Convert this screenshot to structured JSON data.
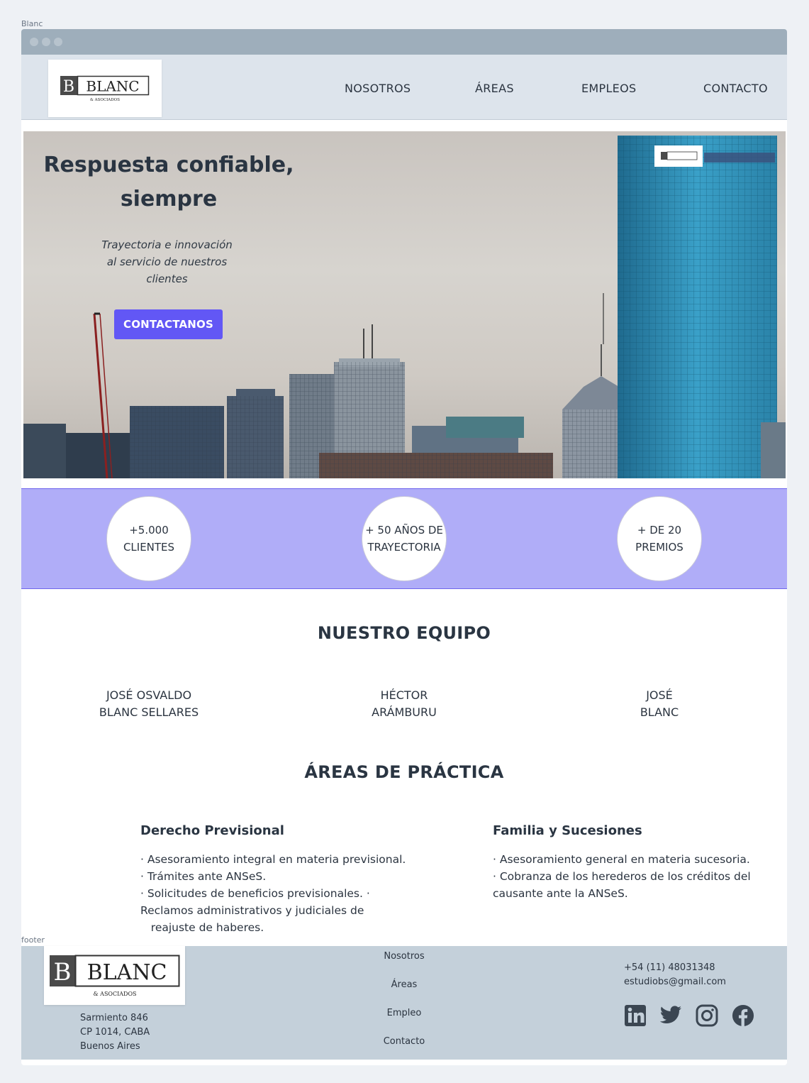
{
  "labels": {
    "top": "Blanc",
    "footer": "footer"
  },
  "logo": {
    "initial": "B",
    "name": "BLANC",
    "tagline": "& ASOCIADOS"
  },
  "nav": {
    "items": [
      "NOSOTROS",
      "ÁREAS",
      "EMPLEOS",
      "CONTACTO"
    ]
  },
  "hero": {
    "title_line1": "Respuesta confiable,",
    "title_line2": "siempre",
    "sub_line1": "Trayectoria e innovación",
    "sub_line2": "al servicio de nuestros",
    "sub_line3": "clientes",
    "cta": "CONTACTANOS"
  },
  "stats": [
    {
      "line1": "+5.000",
      "line2": "CLIENTES"
    },
    {
      "line1": "+ 50 AÑOS DE",
      "line2": "TRAYECTORIA"
    },
    {
      "line1": "+ DE 20",
      "line2": "PREMIOS"
    }
  ],
  "team": {
    "title": "NUESTRO EQUIPO",
    "members": [
      {
        "line1": "JOSÉ OSVALDO",
        "line2": "BLANC SELLARES"
      },
      {
        "line1": "HÉCTOR",
        "line2": "ARÁMBURU"
      },
      {
        "line1": "JOSÉ",
        "line2": "BLANC"
      }
    ]
  },
  "areas": {
    "title": "ÁREAS DE PRÁCTICA",
    "items": [
      {
        "title": "Derecho Previsional",
        "lines": [
          "· Asesoramiento integral en materia previsional.",
          "· Trámites ante ANSeS.",
          "· Solicitudes de beneficios previsionales.  ·",
          "Reclamos administrativos y judiciales de",
          "   reajuste de haberes."
        ]
      },
      {
        "title": "Familia y Sucesiones",
        "lines": [
          "· Asesoramiento general en materia sucesoria.",
          "· Cobranza de los herederos de los créditos del",
          "causante ante la ANSeS."
        ]
      }
    ]
  },
  "footer": {
    "address": [
      "Sarmiento 846",
      "CP 1014, CABA",
      "Buenos Aires"
    ],
    "links": [
      "Nosotros",
      "Áreas",
      "Empleo",
      "Contacto"
    ],
    "phone": "+54 (11) 48031348",
    "email": "estudiobs@gmail.com",
    "social": [
      "linkedin-icon",
      "twitter-icon",
      "instagram-icon",
      "facebook-icon"
    ]
  },
  "colors": {
    "accent": "#6257f5",
    "stats_bg": "#b0adf8",
    "header_bg": "#dde4ec",
    "footer_bg": "#c4d0da"
  }
}
